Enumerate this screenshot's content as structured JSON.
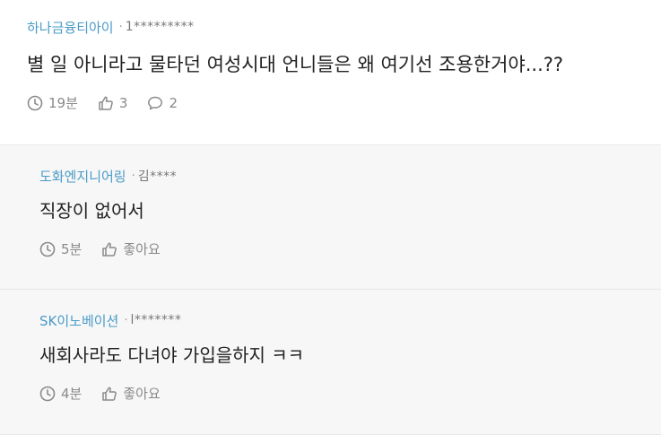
{
  "post": {
    "company": "하나금융티아이",
    "separator": "·",
    "user": "1*********",
    "text": "별 일 아니라고 물타던 여성시대 언니들은 왜 여기선 조용한거야...??",
    "time": "19분",
    "likes": "3",
    "comments": "2"
  },
  "replies": [
    {
      "company": "도화엔지니어링",
      "separator": "·",
      "user": "김****",
      "text": "직장이 없어서",
      "time": "5분",
      "like_label": "좋아요"
    },
    {
      "company": "SK이노베이션",
      "separator": "·",
      "user": "l*******",
      "text": "새회사라도 다녀야 가입을하지 ㅋㅋ",
      "time": "4분",
      "like_label": "좋아요"
    }
  ],
  "icons": {
    "time": "clock-icon",
    "like": "thumbs-up-icon",
    "comment": "speech-bubble-icon"
  },
  "colors": {
    "company": "#4a9bc7",
    "text": "#222222",
    "meta": "#8a8a8a",
    "reply_background": "#f7f7f7"
  }
}
